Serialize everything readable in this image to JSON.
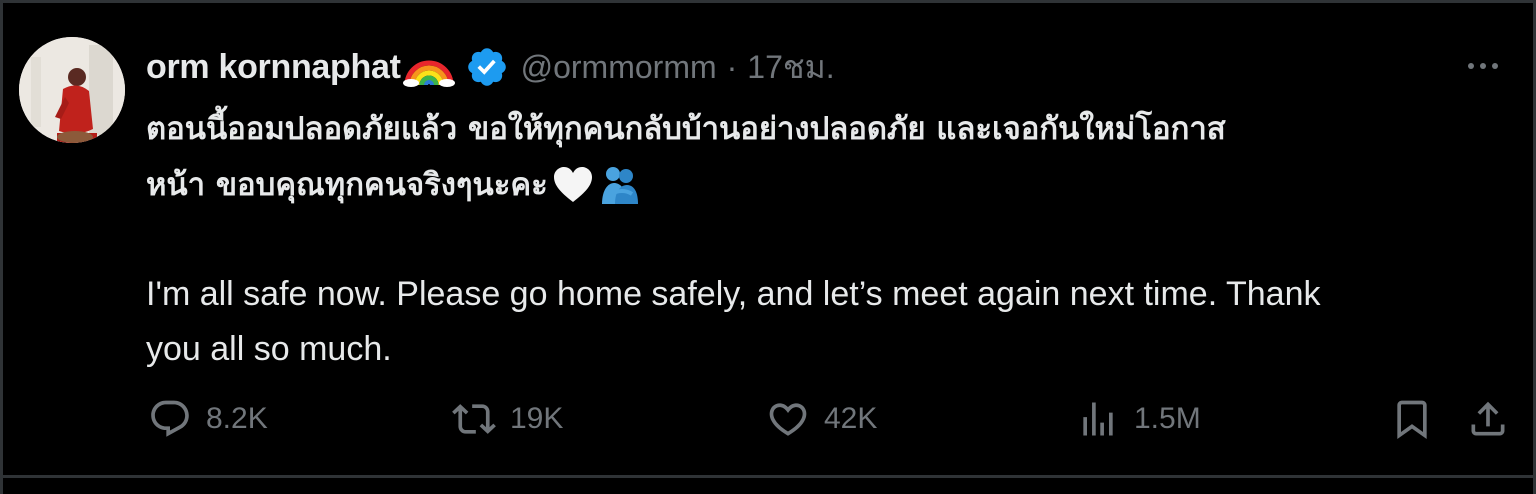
{
  "author": {
    "name": "orm kornnaphat",
    "handle": "@ormmormm",
    "separator": "·",
    "time": "17ชม."
  },
  "tweet": {
    "thai_line_1": "ตอนนี้ออมปลอดภัยแล้ว ขอให้ทุกคนกลับบ้านอย่างปลอดภัย และเจอกันใหม่โอกาส",
    "thai_line_2": "หน้า ขอบคุณทุกคนจริงๆนะคะ",
    "english_line_1": "I'm all safe now. Please go home safely, and let’s meet again next time. Thank",
    "english_line_2": "you all so much."
  },
  "actions": {
    "replies": "8.2K",
    "reposts": "19K",
    "likes": "42K",
    "views": "1.5M"
  },
  "icons": {
    "name_emoji": "rainbow-emoji",
    "verified": "verified-badge-icon",
    "more": "more-icon",
    "text_emoji_1": "white-heart-emoji",
    "text_emoji_2": "people-hugging-emoji",
    "reply": "reply-icon",
    "repost": "repost-icon",
    "like": "heart-icon",
    "views": "views-icon",
    "bookmark": "bookmark-icon",
    "share": "share-icon"
  },
  "colors": {
    "background": "#000000",
    "text": "#e7e9ea",
    "muted": "#71767b",
    "verified": "#1d9bf0",
    "border": "#2f3336"
  }
}
